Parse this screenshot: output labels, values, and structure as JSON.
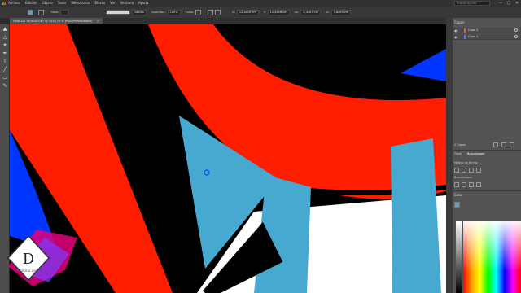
{
  "menubar": {
    "logo": "Ai",
    "items": [
      "Archivo",
      "Edición",
      "Objeto",
      "Texto",
      "Seleccionar",
      "Efecto",
      "Ver",
      "Ventana",
      "Ayuda"
    ],
    "search_placeholder": "Buscar ayuda",
    "window_controls": [
      "—",
      "▢",
      "✕"
    ]
  },
  "controlbar": {
    "trazo_label": "Trazo:",
    "basic_label": "Básico",
    "opacity_label": "Opacidad:",
    "opacity_value": "100%",
    "estilo_label": "Estilo:",
    "x_label": "X:",
    "x_value": "12,4826 cm",
    "y_label": "Y:",
    "y_value": "12,8556 cm",
    "w_label": "An:",
    "w_value": "6,4987 cm",
    "h_label": "Al:",
    "h_value": "5,8665 cm"
  },
  "document": {
    "tab_title": "FINALIZT WOUGST.ai* @ 1216,78 % (RGB/Previsualizar)",
    "tab_close": "✕"
  },
  "panels": {
    "layers_title": "Capas",
    "layers": [
      {
        "name": "Capa 2",
        "color": "#ff4f4f"
      },
      {
        "name": "Capa 1",
        "color": "#4f7bff"
      }
    ],
    "layer_count": "2 Capas",
    "tabs": [
      "Trazo",
      "Buscatrazos"
    ],
    "pathfinder_modes_label": "Modos de forma:",
    "pathfinder_label": "Buscatrazos:",
    "color_title": "Color"
  },
  "colors": {
    "red": "#ff1d00",
    "blue_light": "#47a9cf",
    "blue_dark": "#0036ff",
    "black": "#000000",
    "white": "#ffffff"
  },
  "watermark": {
    "letter": "D",
    "text": "DIGITAL LAB"
  }
}
